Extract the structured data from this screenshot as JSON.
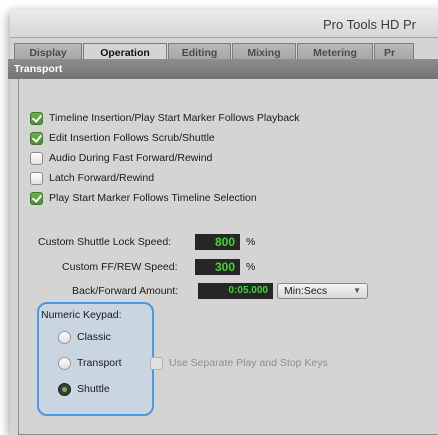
{
  "window": {
    "title": "Pro Tools HD Pr"
  },
  "tabs": [
    "Display",
    "Operation",
    "Editing",
    "Mixing",
    "Metering",
    "Pr"
  ],
  "active_tab": "Operation",
  "section": {
    "title": "Transport"
  },
  "checkboxes": [
    {
      "label": "Timeline Insertion/Play Start Marker Follows Playback",
      "checked": true
    },
    {
      "label": "Edit Insertion Follows Scrub/Shuttle",
      "checked": true
    },
    {
      "label": "Audio During Fast Forward/Rewind",
      "checked": false
    },
    {
      "label": "Latch Forward/Rewind",
      "checked": false
    },
    {
      "label": "Play Start Marker Follows Timeline Selection",
      "checked": true
    }
  ],
  "fields": {
    "shuttle_lock": {
      "label": "Custom Shuttle Lock Speed:",
      "value": "800",
      "unit": "%"
    },
    "ff_rew": {
      "label": "Custom FF/REW Speed:",
      "value": "300",
      "unit": "%"
    },
    "back_forward": {
      "label": "Back/Forward Amount:",
      "value": "0:05.000",
      "unit_selected": "Min:Secs"
    }
  },
  "numeric_keypad": {
    "label": "Numeric Keypad:",
    "options": [
      "Classic",
      "Transport",
      "Shuttle"
    ],
    "selected": "Shuttle"
  },
  "separate_keys": {
    "label": "Use Separate Play and Stop Keys",
    "checked": false,
    "disabled": true
  },
  "colors": {
    "accent_green": "#4a8d2f",
    "counter_text": "#3ed832",
    "highlight_border": "#4a9ae0"
  }
}
